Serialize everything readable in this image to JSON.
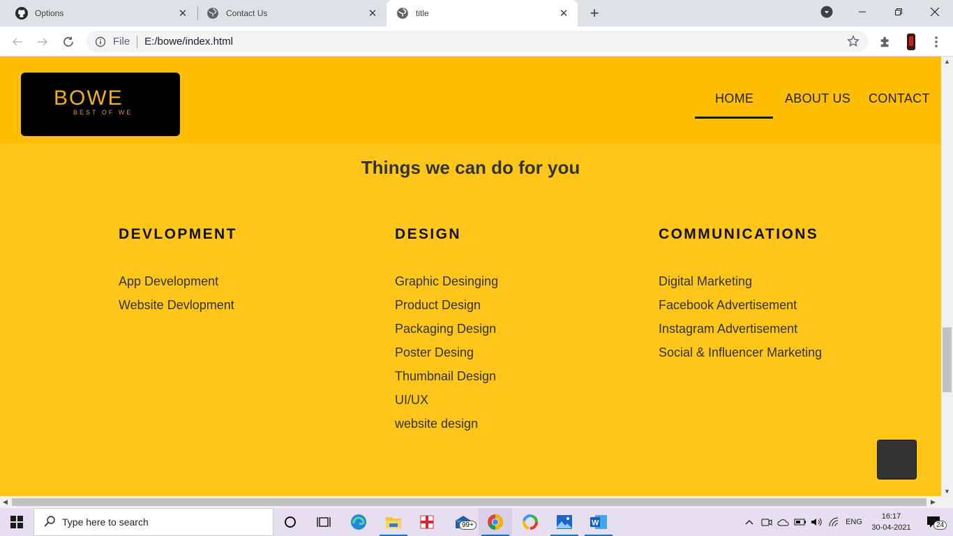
{
  "browser": {
    "tabs": [
      {
        "title": "Options",
        "icon": "github-icon",
        "active": false
      },
      {
        "title": "Contact Us",
        "icon": "globe-icon",
        "active": false
      },
      {
        "title": "title",
        "icon": "globe-icon",
        "active": true
      }
    ],
    "address": {
      "scheme_label": "File",
      "url": "E:/bowe/index.html"
    }
  },
  "site": {
    "logo": {
      "word": "BOWE",
      "tagline": "BEST OF WE"
    },
    "nav": [
      {
        "label": "HOME",
        "active": true
      },
      {
        "label": "ABOUT US",
        "active": false
      },
      {
        "label": "CONTACT",
        "active": false
      }
    ],
    "section_title": "Things we can do for you",
    "columns": [
      {
        "heading": "DEVLOPMENT",
        "items": [
          "App Development",
          "Website Devlopment"
        ]
      },
      {
        "heading": "DESIGN",
        "items": [
          "Graphic Desinging",
          "Product Design",
          "Packaging Design",
          "Poster Desing",
          "Thumbnail Design",
          "UI/UX",
          "website design"
        ]
      },
      {
        "heading": "COMMUNICATIONS",
        "items": [
          "Digital Marketing",
          "Facebook Advertisement",
          "Instagram Advertisement",
          "Social & Influencer Marketing"
        ]
      }
    ],
    "colors": {
      "header_bg": "#ffbf00",
      "page_bg": "#ffc61a",
      "back_to_top": "#333333"
    }
  },
  "taskbar": {
    "search_placeholder": "Type here to search",
    "mail_badge": "99+",
    "language": "ENG",
    "time": "16:17",
    "date": "30-04-2021",
    "notifications": "24"
  }
}
